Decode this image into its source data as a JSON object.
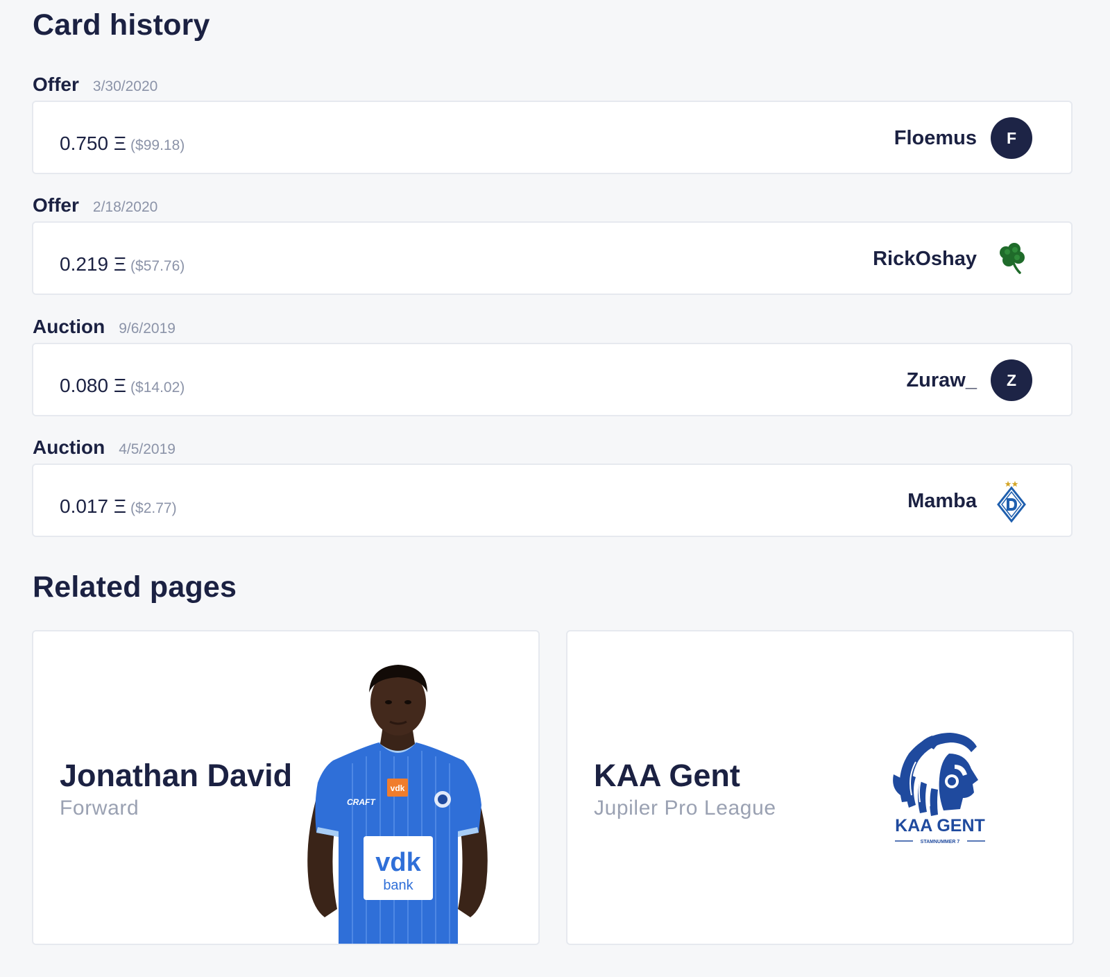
{
  "card_history": {
    "title": "Card history",
    "entries": [
      {
        "type": "Offer",
        "date": "3/30/2020",
        "eth": "0.750 Ξ",
        "usd": "($99.18)",
        "user": "Floemus",
        "avatar": {
          "kind": "letter",
          "letter": "F"
        }
      },
      {
        "type": "Offer",
        "date": "2/18/2020",
        "eth": "0.219 Ξ",
        "usd": "($57.76)",
        "user": "RickOshay",
        "avatar": {
          "kind": "icon",
          "icon": "shamrock-icon"
        }
      },
      {
        "type": "Auction",
        "date": "9/6/2019",
        "eth": "0.080 Ξ",
        "usd": "($14.02)",
        "user": "Zuraw_",
        "avatar": {
          "kind": "letter",
          "letter": "Z"
        }
      },
      {
        "type": "Auction",
        "date": "4/5/2019",
        "eth": "0.017 Ξ",
        "usd": "($2.77)",
        "user": "Mamba",
        "avatar": {
          "kind": "icon",
          "icon": "dynamo-crest-icon"
        }
      }
    ]
  },
  "related_pages": {
    "title": "Related pages",
    "player": {
      "name": "Jonathan David",
      "subtitle": "Forward",
      "image": "player-photo",
      "shirt_sponsor": "vdk",
      "shirt_sponsor_sub": "bank",
      "shirt_brand": "CRAFT"
    },
    "club": {
      "name": "KAA Gent",
      "subtitle": "Jupiler Pro League",
      "logo_text": "KAA GENT",
      "logo_subtext": "STAMNUMMER 7"
    }
  },
  "colors": {
    "background": "#f6f7f9",
    "text_dark": "#1b2142",
    "text_muted": "#8b93a8",
    "avatar_dark": "#1d2446",
    "gent_blue": "#1f4a9e",
    "jersey_blue": "#2f6fd8"
  }
}
